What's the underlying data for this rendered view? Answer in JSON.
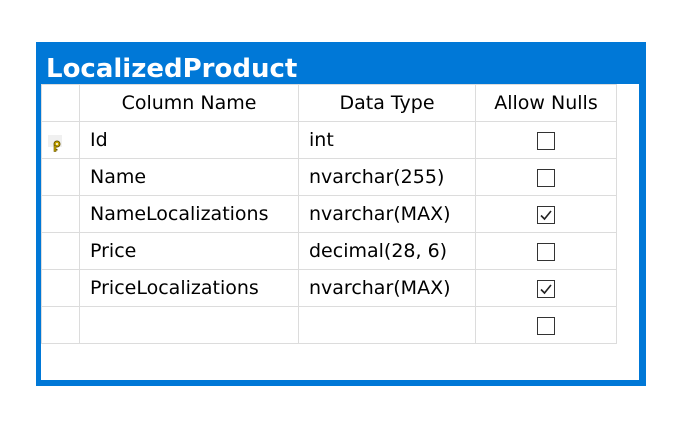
{
  "window": {
    "title": "LocalizedProduct"
  },
  "columns": {
    "headers": [
      "Column Name",
      "Data Type",
      "Allow Nulls"
    ]
  },
  "rows": [
    {
      "name": "Id",
      "type": "int",
      "allow_nulls": false,
      "primary_key": true
    },
    {
      "name": "Name",
      "type": "nvarchar(255)",
      "allow_nulls": false,
      "primary_key": false
    },
    {
      "name": "NameLocalizations",
      "type": "nvarchar(MAX)",
      "allow_nulls": true,
      "primary_key": false
    },
    {
      "name": "Price",
      "type": "decimal(28, 6)",
      "allow_nulls": false,
      "primary_key": false
    },
    {
      "name": "PriceLocalizations",
      "type": "nvarchar(MAX)",
      "allow_nulls": true,
      "primary_key": false
    },
    {
      "name": "",
      "type": "",
      "allow_nulls": false,
      "primary_key": false
    }
  ],
  "icons": {
    "primary_key": "key-icon",
    "check": "checkmark-icon"
  },
  "colors": {
    "title_bar": "#0078d7",
    "title_text": "#ffffff",
    "key": "#c8a800"
  }
}
